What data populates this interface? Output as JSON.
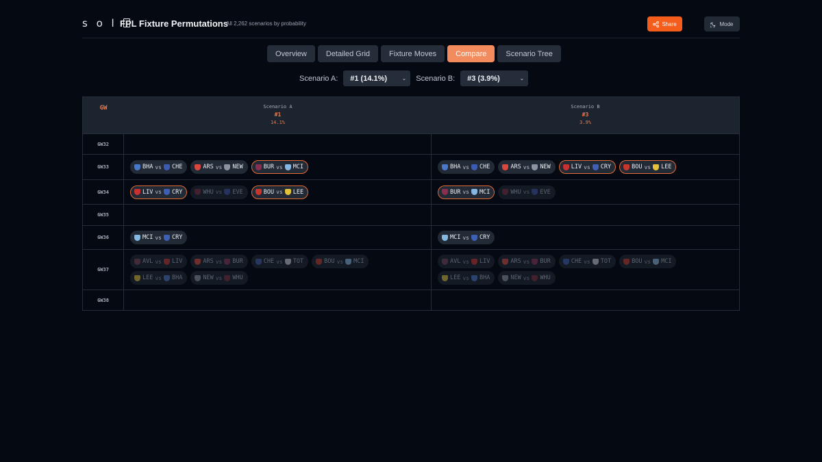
{
  "header": {
    "logo_text": "so",
    "logo_tail": "",
    "title": "FPL Fixture Permutations",
    "subtitle": "All 2,262 scenarios by probability",
    "share_label": "Share",
    "mode_label": "Mode",
    "share_icon": "share-icon",
    "mode_icon": "moon-icon"
  },
  "tabs": [
    {
      "label": "Overview",
      "active": false
    },
    {
      "label": "Detailed Grid",
      "active": false
    },
    {
      "label": "Fixture Moves",
      "active": false
    },
    {
      "label": "Compare",
      "active": true
    },
    {
      "label": "Scenario Tree",
      "active": false
    }
  ],
  "selectors": {
    "a_label": "Scenario A:",
    "a_value": "#1 (14.1%)",
    "b_label": "Scenario B:",
    "b_value": "#3 (3.9%)"
  },
  "table": {
    "gw_header": "GW",
    "scenario_a": {
      "name": "Scenario A",
      "num": "#1",
      "prob": "14.1%"
    },
    "scenario_b": {
      "name": "Scenario B",
      "num": "#3",
      "prob": "3.9%"
    }
  },
  "team_colors": {
    "BHA": "#4a78c8",
    "CHE": "#3c5bb0",
    "ARS": "#d9473f",
    "NEW": "#8b93a1",
    "BUR": "#8a2f4f",
    "MCI": "#86b7e0",
    "LIV": "#c8312f",
    "CRY": "#3f5eb5",
    "WHU": "#7b2b3c",
    "EVE": "#3b4fa5",
    "BOU": "#c7352b",
    "LEE": "#e3c23a",
    "AVL": "#7c3d55",
    "TOT": "#c8ccd4"
  },
  "rows": [
    {
      "gw": "GW32",
      "a": [],
      "b": []
    },
    {
      "gw": "GW33",
      "a": [
        {
          "home": "BHA",
          "away": "CHE",
          "state": "normal"
        },
        {
          "home": "ARS",
          "away": "NEW",
          "state": "normal"
        },
        {
          "home": "BUR",
          "away": "MCI",
          "state": "hl"
        }
      ],
      "b": [
        {
          "home": "BHA",
          "away": "CHE",
          "state": "normal"
        },
        {
          "home": "ARS",
          "away": "NEW",
          "state": "normal"
        },
        {
          "home": "LIV",
          "away": "CRY",
          "state": "hl"
        },
        {
          "home": "BOU",
          "away": "LEE",
          "state": "hl"
        }
      ]
    },
    {
      "gw": "GW34",
      "a": [
        {
          "home": "LIV",
          "away": "CRY",
          "state": "hl"
        },
        {
          "home": "WHU",
          "away": "EVE",
          "state": "dim"
        },
        {
          "home": "BOU",
          "away": "LEE",
          "state": "hl"
        }
      ],
      "b": [
        {
          "home": "BUR",
          "away": "MCI",
          "state": "hl"
        },
        {
          "home": "WHU",
          "away": "EVE",
          "state": "dim"
        }
      ]
    },
    {
      "gw": "GW35",
      "a": [],
      "b": []
    },
    {
      "gw": "GW36",
      "a": [
        {
          "home": "MCI",
          "away": "CRY",
          "state": "normal"
        }
      ],
      "b": [
        {
          "home": "MCI",
          "away": "CRY",
          "state": "normal"
        }
      ]
    },
    {
      "gw": "GW37",
      "a": [
        {
          "home": "AVL",
          "away": "LIV",
          "state": "dim"
        },
        {
          "home": "ARS",
          "away": "BUR",
          "state": "dim"
        },
        {
          "home": "CHE",
          "away": "TOT",
          "state": "dim"
        },
        {
          "home": "BOU",
          "away": "MCI",
          "state": "dim"
        },
        {
          "home": "LEE",
          "away": "BHA",
          "state": "dim"
        },
        {
          "home": "NEW",
          "away": "WHU",
          "state": "dim"
        }
      ],
      "b": [
        {
          "home": "AVL",
          "away": "LIV",
          "state": "dim"
        },
        {
          "home": "ARS",
          "away": "BUR",
          "state": "dim"
        },
        {
          "home": "CHE",
          "away": "TOT",
          "state": "dim"
        },
        {
          "home": "BOU",
          "away": "MCI",
          "state": "dim"
        },
        {
          "home": "LEE",
          "away": "BHA",
          "state": "dim"
        },
        {
          "home": "NEW",
          "away": "WHU",
          "state": "dim"
        }
      ]
    },
    {
      "gw": "GW38",
      "a": [],
      "b": []
    }
  ],
  "vs_text": "vs"
}
